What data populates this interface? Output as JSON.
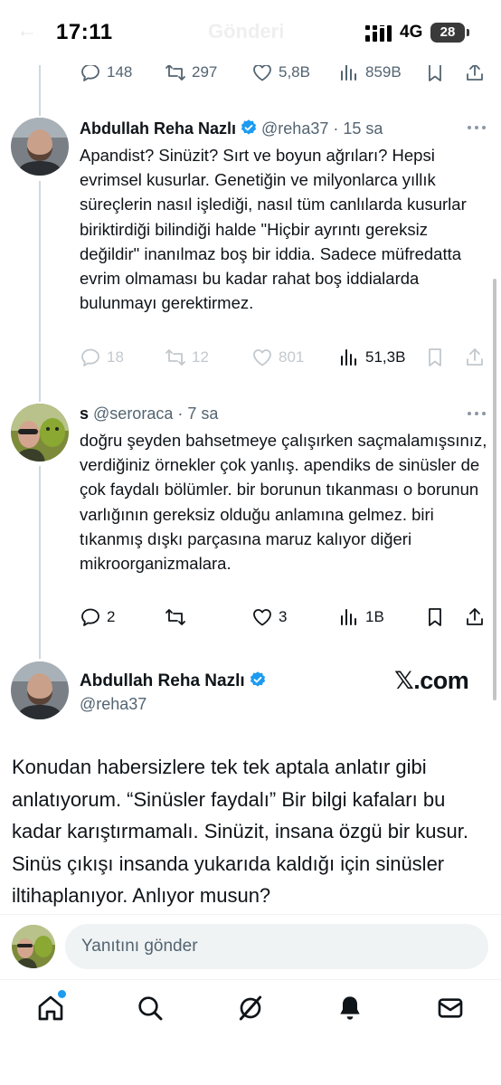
{
  "status_bar": {
    "time": "17:11",
    "ghost_title": "Gönderi",
    "network": "4G",
    "battery": "28"
  },
  "top_actions": {
    "replies": "148",
    "reposts": "297",
    "likes": "5,8B",
    "views": "859B"
  },
  "reply1": {
    "name": "Abdullah Reha Nazlı",
    "handle": "@reha37",
    "time": "15 sa",
    "text": "Apandist? Sinüzit? Sırt ve boyun ağrıları? Hepsi evrimsel kusurlar. Genetiğin ve milyonlarca yıllık süreçlerin nasıl işlediği, nasıl tüm canlılarda kusurlar biriktirdiği bilindiği halde \"Hiçbir ayrıntı gereksiz değildir\" inanılmaz boş bir iddia. Sadece müfredatta evrim olmaması bu kadar rahat boş iddialarda bulunmayı gerektirmez.",
    "replies": "18",
    "reposts": "12",
    "likes": "801",
    "views": "51,3B"
  },
  "reply2": {
    "name": "s",
    "handle": "@seroraca",
    "time": "7 sa",
    "text": "doğru şeyden bahsetmeye çalışırken saçmalamışsınız, verdiğiniz örnekler çok yanlış. apendiks de sinüsler de çok faydalı bölümler. bir borunun tıkanması o borunun varlığının gereksiz olduğu anlamına gelmez. biri tıkanmış dışkı parçasına maruz kalıyor diğeri mikroorganizmalara.",
    "replies": "2",
    "reposts": "",
    "likes": "3",
    "views": "1B"
  },
  "main_tweet": {
    "name": "Abdullah Reha Nazlı",
    "handle": "@reha37",
    "brand": "𝕏.com",
    "text": "Konudan habersizlere tek tek aptala anlatır gibi anlatıyorum. “Sinüsler faydalı” Bir bilgi kafaları bu kadar karıştırmamalı. Sinüzit, insana özgü bir kusur. Sinüs çıkışı insanda yukarıda kaldığı için sinüsler iltihaplanıyor. Anlıyor musun?"
  },
  "reply_bar": {
    "placeholder": "Yanıtını gönder"
  },
  "icons": {
    "reply": "reply-icon",
    "repost": "repost-icon",
    "like": "heart-icon",
    "views": "views-icon",
    "bookmark": "bookmark-icon",
    "share": "share-icon",
    "verified": "verified-badge-icon",
    "tabs": [
      "home-icon",
      "search-icon",
      "grok-icon",
      "notifications-icon",
      "messages-icon"
    ]
  },
  "colors": {
    "accent": "#1d9bf0",
    "text": "#0f1419",
    "secondary": "#536471"
  }
}
